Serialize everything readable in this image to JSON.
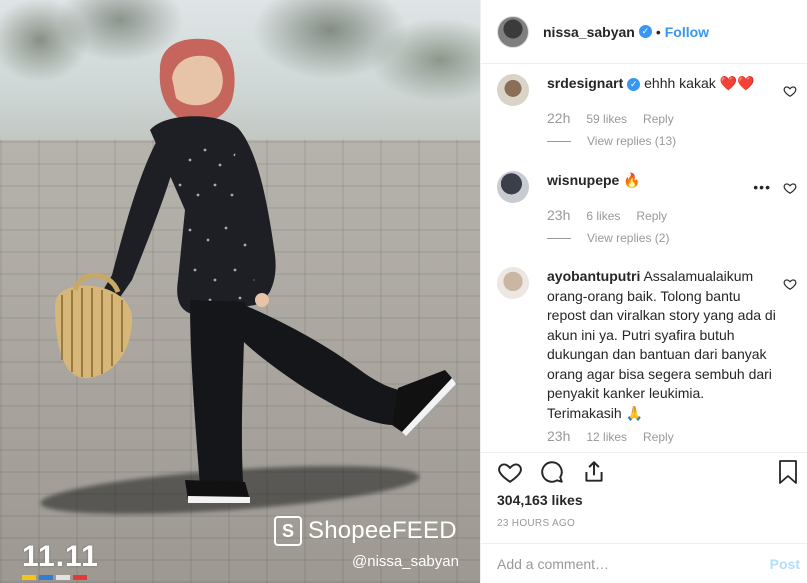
{
  "photo": {
    "brand_logo_glyph": "S",
    "brand_text": "ShopeeFEED",
    "handle": "@nissa_sabyan",
    "event_logo": "11.11",
    "event_colors": [
      "#f5c518",
      "#2f7fd1",
      "#e2e2e2",
      "#2f7fd1",
      "#e53935"
    ]
  },
  "header": {
    "username": "nissa_sabyan",
    "verified_icon": "verified-badge-icon",
    "separator": "•",
    "follow_label": "Follow"
  },
  "comments": [
    {
      "username": "srdesignart",
      "verified": true,
      "text": "ehhh kakak ❤️❤️",
      "time": "22h",
      "likes": "59 likes",
      "reply_label": "Reply",
      "view_replies": "View replies (13)"
    },
    {
      "username": "wisnupepe",
      "verified": false,
      "text": "🔥",
      "time": "23h",
      "likes": "6 likes",
      "reply_label": "Reply",
      "view_replies": "View replies (2)",
      "more_label": "•••"
    },
    {
      "username": "ayobantuputri",
      "verified": false,
      "text": "Assalamualaikum orang-orang baik. Tolong bantu repost dan viralkan story yang ada di akun ini ya. Putri syafira butuh dukungan dan bantuan dari banyak orang agar bisa segera sembuh dari penyakit kanker leukimia. Terimakasih 🙏",
      "time": "23h",
      "likes": "12 likes",
      "reply_label": "Reply"
    }
  ],
  "actions": {
    "icons": [
      "heart-icon",
      "comment-icon",
      "share-icon",
      "bookmark-icon"
    ],
    "likes_count": "304,163 likes",
    "post_time": "23 HOURS AGO"
  },
  "add_comment": {
    "placeholder": "Add a comment…",
    "post_label": "Post"
  },
  "colors": {
    "accent": "#3897f0",
    "post_disabled": "#b2dffc",
    "muted": "#999999",
    "border": "#efefef"
  }
}
